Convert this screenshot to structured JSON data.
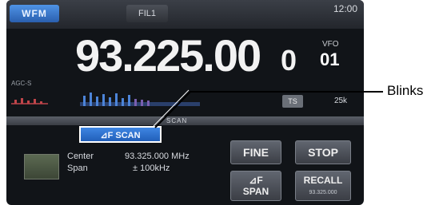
{
  "top": {
    "mode": "WFM",
    "filter": "FIL1",
    "clock": "12:00"
  },
  "frequency": {
    "main": "93.225.00",
    "last_digit": "0",
    "vfo_label": "VFO",
    "vfo_number": "01"
  },
  "meter": {
    "agc_label": "AGC-S"
  },
  "step": {
    "ts_label": "TS",
    "value": "25k"
  },
  "scan": {
    "title": "SCAN",
    "indicator": "⊿F SCAN",
    "center_label": "Center",
    "center_value": "93.325.000 MHz",
    "span_label": "Span",
    "span_value": "± 100kHz"
  },
  "buttons": {
    "fine": "FINE",
    "stop": "STOP",
    "dfspan_line1": "⊿F",
    "dfspan_line2": "SPAN",
    "recall": "RECALL",
    "recall_sub": "93.325.000"
  },
  "callout": {
    "text": "Blinks"
  }
}
